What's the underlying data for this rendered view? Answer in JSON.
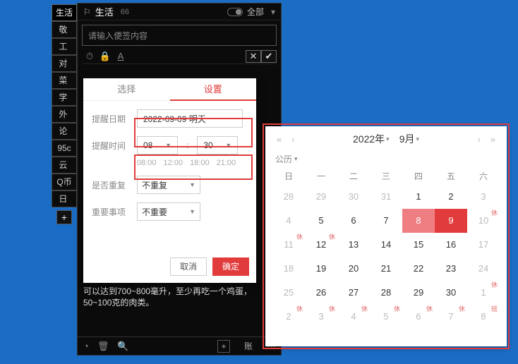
{
  "left_tabs": {
    "active_index": 0,
    "items": [
      "生活",
      "敬 ",
      "工 ",
      "对 ",
      "菜 ",
      "学 ",
      "外 ",
      "论 ",
      "95c",
      "云 ",
      "Q币",
      "日 "
    ],
    "add_label": "+"
  },
  "header": {
    "title": "生活",
    "count": "66",
    "all_label": "全部"
  },
  "note": {
    "placeholder": "请输入便签内容"
  },
  "toolbar": {
    "clock": "⏱",
    "lock": "🔒",
    "under": "A",
    "close": "✕",
    "confirm": "✔"
  },
  "settings": {
    "tab_select": "选择",
    "tab_set": "设置",
    "date_label": "提醒日期",
    "date_value": "2022-09-09 明天",
    "time_label": "提醒时间",
    "hour": "08",
    "minute": "30",
    "presets": [
      "08:00",
      "12:00",
      "18:00",
      "21:00"
    ],
    "repeat_label": "是否重复",
    "repeat_value": "不重复",
    "important_label": "重要事项",
    "important_value": "不重要",
    "cancel": "取消",
    "ok": "确定"
  },
  "calendar": {
    "year": "2022年",
    "month": "9月",
    "subtype": "公历",
    "dow": [
      "日",
      "一",
      "二",
      "三",
      "四",
      "五",
      "六"
    ],
    "rows": [
      [
        {
          "d": "28",
          "other": true
        },
        {
          "d": "29",
          "other": true
        },
        {
          "d": "30",
          "other": true
        },
        {
          "d": "31",
          "other": true
        },
        {
          "d": "1"
        },
        {
          "d": "2"
        },
        {
          "d": "3",
          "wkend": true
        }
      ],
      [
        {
          "d": "4",
          "wkend": true
        },
        {
          "d": "5"
        },
        {
          "d": "6"
        },
        {
          "d": "7"
        },
        {
          "d": "8",
          "today": true
        },
        {
          "d": "9",
          "sel": true
        },
        {
          "d": "10",
          "wkend": true,
          "b": "休"
        }
      ],
      [
        {
          "d": "11",
          "wkend": true,
          "b": "休"
        },
        {
          "d": "12",
          "b": "休"
        },
        {
          "d": "13"
        },
        {
          "d": "14"
        },
        {
          "d": "15"
        },
        {
          "d": "16"
        },
        {
          "d": "17",
          "wkend": true
        }
      ],
      [
        {
          "d": "18",
          "wkend": true
        },
        {
          "d": "19"
        },
        {
          "d": "20"
        },
        {
          "d": "21"
        },
        {
          "d": "22"
        },
        {
          "d": "23"
        },
        {
          "d": "24",
          "wkend": true
        }
      ],
      [
        {
          "d": "25",
          "wkend": true
        },
        {
          "d": "26"
        },
        {
          "d": "27"
        },
        {
          "d": "28"
        },
        {
          "d": "29"
        },
        {
          "d": "30"
        },
        {
          "d": "1",
          "other": true,
          "b": "休"
        }
      ],
      [
        {
          "d": "2",
          "other": true,
          "b": "休"
        },
        {
          "d": "3",
          "other": true,
          "b": "休"
        },
        {
          "d": "4",
          "other": true,
          "b": "休"
        },
        {
          "d": "5",
          "other": true,
          "b": "休"
        },
        {
          "d": "6",
          "other": true,
          "b": "休"
        },
        {
          "d": "7",
          "other": true,
          "b": "休"
        },
        {
          "d": "8",
          "other": true,
          "b": "班"
        }
      ]
    ]
  },
  "body_text": "可以达到700~800毫升，至少再吃一个鸡蛋，50~100克的肉类。",
  "footer": {
    "clock": "◔",
    "trash": "🗑",
    "search": "🔍",
    "add": "+",
    "acct": "账",
    "pipe": "⋯"
  }
}
